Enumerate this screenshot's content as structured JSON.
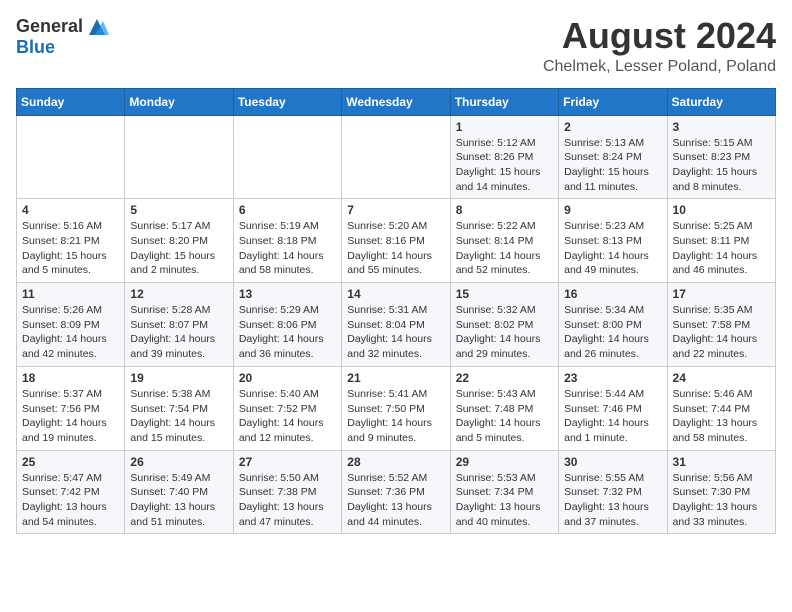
{
  "header": {
    "logo_general": "General",
    "logo_blue": "Blue",
    "month_title": "August 2024",
    "subtitle": "Chelmek, Lesser Poland, Poland"
  },
  "days_of_week": [
    "Sunday",
    "Monday",
    "Tuesday",
    "Wednesday",
    "Thursday",
    "Friday",
    "Saturday"
  ],
  "weeks": [
    [
      {
        "day": "",
        "info": ""
      },
      {
        "day": "",
        "info": ""
      },
      {
        "day": "",
        "info": ""
      },
      {
        "day": "",
        "info": ""
      },
      {
        "day": "1",
        "info": "Sunrise: 5:12 AM\nSunset: 8:26 PM\nDaylight: 15 hours\nand 14 minutes."
      },
      {
        "day": "2",
        "info": "Sunrise: 5:13 AM\nSunset: 8:24 PM\nDaylight: 15 hours\nand 11 minutes."
      },
      {
        "day": "3",
        "info": "Sunrise: 5:15 AM\nSunset: 8:23 PM\nDaylight: 15 hours\nand 8 minutes."
      }
    ],
    [
      {
        "day": "4",
        "info": "Sunrise: 5:16 AM\nSunset: 8:21 PM\nDaylight: 15 hours\nand 5 minutes."
      },
      {
        "day": "5",
        "info": "Sunrise: 5:17 AM\nSunset: 8:20 PM\nDaylight: 15 hours\nand 2 minutes."
      },
      {
        "day": "6",
        "info": "Sunrise: 5:19 AM\nSunset: 8:18 PM\nDaylight: 14 hours\nand 58 minutes."
      },
      {
        "day": "7",
        "info": "Sunrise: 5:20 AM\nSunset: 8:16 PM\nDaylight: 14 hours\nand 55 minutes."
      },
      {
        "day": "8",
        "info": "Sunrise: 5:22 AM\nSunset: 8:14 PM\nDaylight: 14 hours\nand 52 minutes."
      },
      {
        "day": "9",
        "info": "Sunrise: 5:23 AM\nSunset: 8:13 PM\nDaylight: 14 hours\nand 49 minutes."
      },
      {
        "day": "10",
        "info": "Sunrise: 5:25 AM\nSunset: 8:11 PM\nDaylight: 14 hours\nand 46 minutes."
      }
    ],
    [
      {
        "day": "11",
        "info": "Sunrise: 5:26 AM\nSunset: 8:09 PM\nDaylight: 14 hours\nand 42 minutes."
      },
      {
        "day": "12",
        "info": "Sunrise: 5:28 AM\nSunset: 8:07 PM\nDaylight: 14 hours\nand 39 minutes."
      },
      {
        "day": "13",
        "info": "Sunrise: 5:29 AM\nSunset: 8:06 PM\nDaylight: 14 hours\nand 36 minutes."
      },
      {
        "day": "14",
        "info": "Sunrise: 5:31 AM\nSunset: 8:04 PM\nDaylight: 14 hours\nand 32 minutes."
      },
      {
        "day": "15",
        "info": "Sunrise: 5:32 AM\nSunset: 8:02 PM\nDaylight: 14 hours\nand 29 minutes."
      },
      {
        "day": "16",
        "info": "Sunrise: 5:34 AM\nSunset: 8:00 PM\nDaylight: 14 hours\nand 26 minutes."
      },
      {
        "day": "17",
        "info": "Sunrise: 5:35 AM\nSunset: 7:58 PM\nDaylight: 14 hours\nand 22 minutes."
      }
    ],
    [
      {
        "day": "18",
        "info": "Sunrise: 5:37 AM\nSunset: 7:56 PM\nDaylight: 14 hours\nand 19 minutes."
      },
      {
        "day": "19",
        "info": "Sunrise: 5:38 AM\nSunset: 7:54 PM\nDaylight: 14 hours\nand 15 minutes."
      },
      {
        "day": "20",
        "info": "Sunrise: 5:40 AM\nSunset: 7:52 PM\nDaylight: 14 hours\nand 12 minutes."
      },
      {
        "day": "21",
        "info": "Sunrise: 5:41 AM\nSunset: 7:50 PM\nDaylight: 14 hours\nand 9 minutes."
      },
      {
        "day": "22",
        "info": "Sunrise: 5:43 AM\nSunset: 7:48 PM\nDaylight: 14 hours\nand 5 minutes."
      },
      {
        "day": "23",
        "info": "Sunrise: 5:44 AM\nSunset: 7:46 PM\nDaylight: 14 hours\nand 1 minute."
      },
      {
        "day": "24",
        "info": "Sunrise: 5:46 AM\nSunset: 7:44 PM\nDaylight: 13 hours\nand 58 minutes."
      }
    ],
    [
      {
        "day": "25",
        "info": "Sunrise: 5:47 AM\nSunset: 7:42 PM\nDaylight: 13 hours\nand 54 minutes."
      },
      {
        "day": "26",
        "info": "Sunrise: 5:49 AM\nSunset: 7:40 PM\nDaylight: 13 hours\nand 51 minutes."
      },
      {
        "day": "27",
        "info": "Sunrise: 5:50 AM\nSunset: 7:38 PM\nDaylight: 13 hours\nand 47 minutes."
      },
      {
        "day": "28",
        "info": "Sunrise: 5:52 AM\nSunset: 7:36 PM\nDaylight: 13 hours\nand 44 minutes."
      },
      {
        "day": "29",
        "info": "Sunrise: 5:53 AM\nSunset: 7:34 PM\nDaylight: 13 hours\nand 40 minutes."
      },
      {
        "day": "30",
        "info": "Sunrise: 5:55 AM\nSunset: 7:32 PM\nDaylight: 13 hours\nand 37 minutes."
      },
      {
        "day": "31",
        "info": "Sunrise: 5:56 AM\nSunset: 7:30 PM\nDaylight: 13 hours\nand 33 minutes."
      }
    ]
  ]
}
